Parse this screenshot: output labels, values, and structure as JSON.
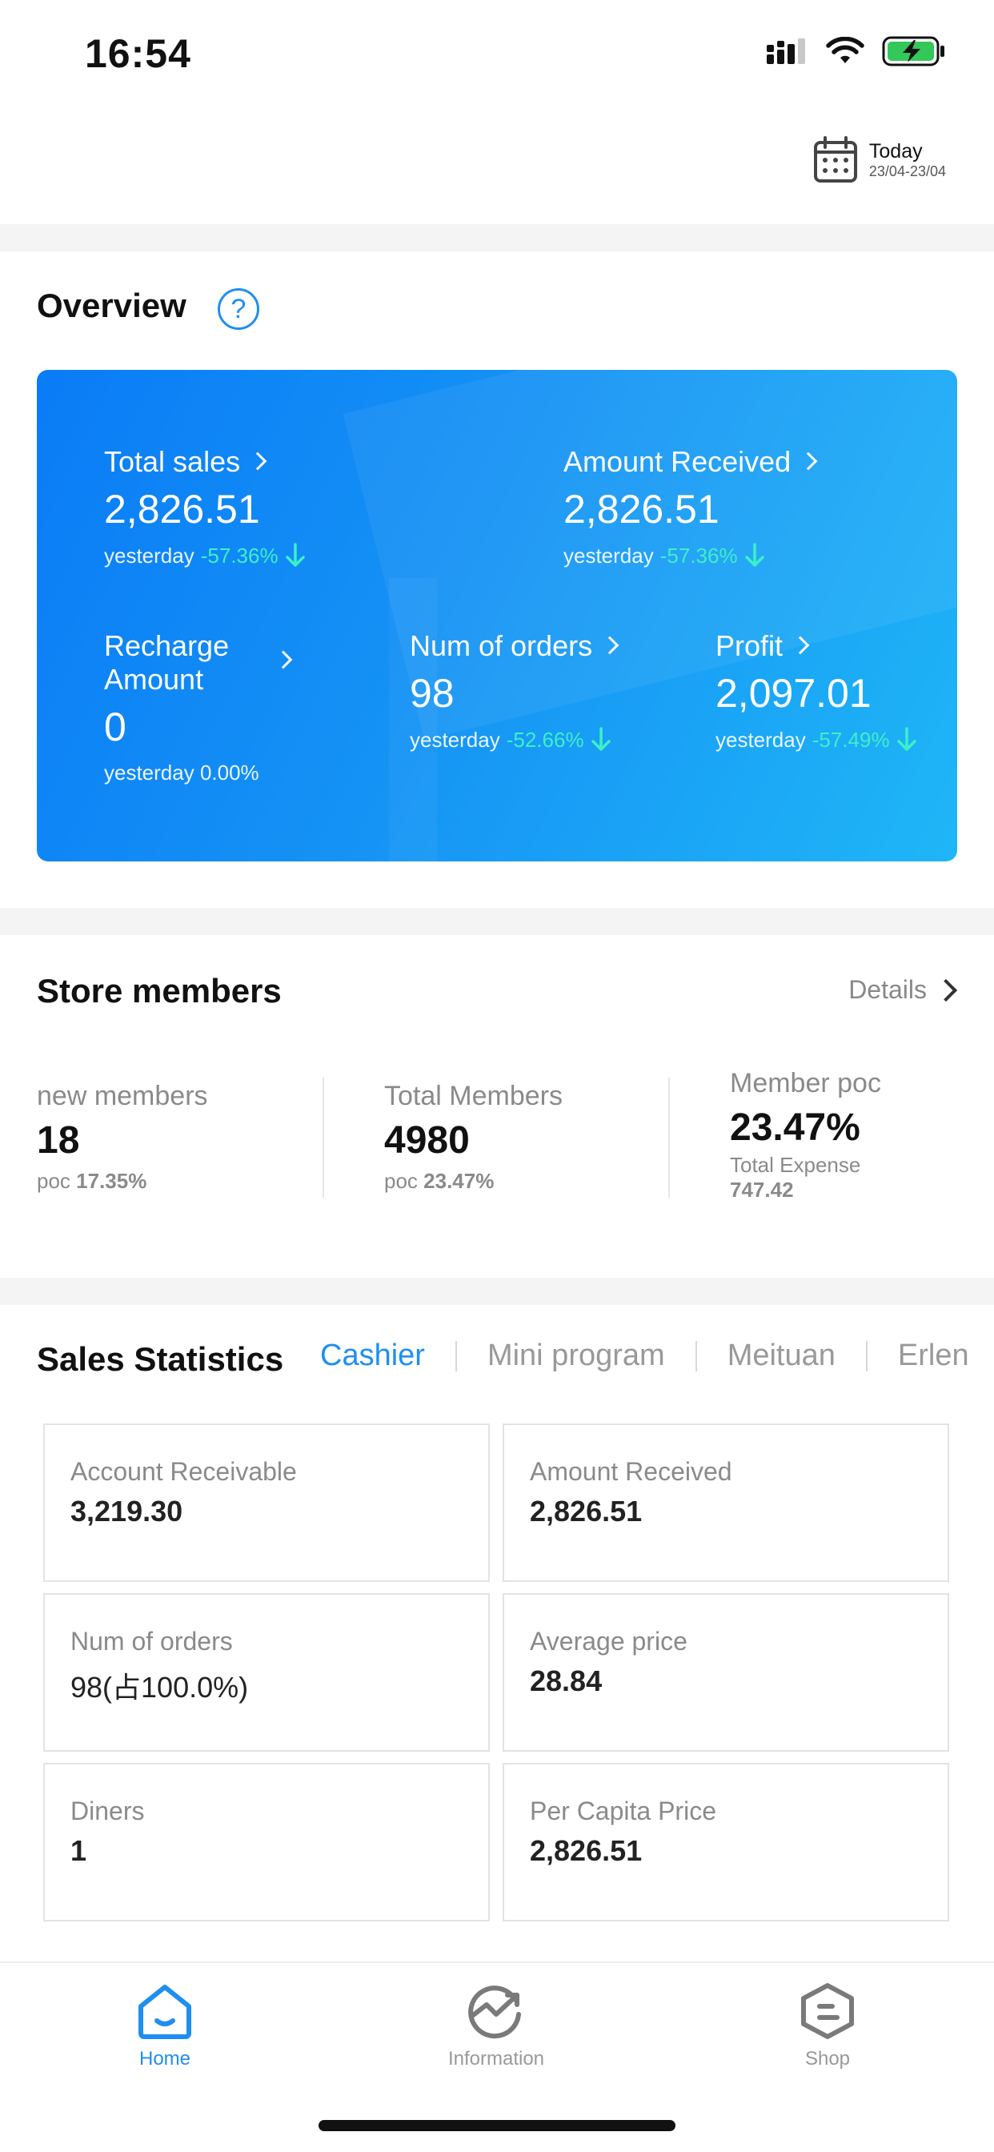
{
  "status_bar": {
    "time": "16:54",
    "icons": [
      "cellular-signal-icon",
      "wifi-icon",
      "battery-charging-icon"
    ]
  },
  "date_picker": {
    "label": "Today",
    "range": "23/04-23/04"
  },
  "overview": {
    "title": "Overview",
    "help_symbol": "?",
    "metrics": {
      "total_sales": {
        "label": "Total sales",
        "value": "2,826.51",
        "prefix": "yesterday",
        "change": "-57.36%"
      },
      "amount_received": {
        "label": "Amount Received",
        "value": "2,826.51",
        "prefix": "yesterday",
        "change": "-57.36%"
      },
      "recharge_amount": {
        "label_line1": "Recharge",
        "label_line2": "Amount",
        "value": "0",
        "sub": "yesterday 0.00%"
      },
      "num_orders": {
        "label": "Num of orders",
        "value": "98",
        "prefix": "yesterday",
        "change": "-52.66%"
      },
      "profit": {
        "label": "Profit",
        "value": "2,097.01",
        "prefix": "yesterday",
        "change": "-57.49%"
      }
    },
    "colors": {
      "card_start": "#0a7cf6",
      "card_end": "#1fb6f6",
      "change": "#3ef0c6"
    }
  },
  "store_members": {
    "title": "Store members",
    "details_label": "Details",
    "new_members": {
      "label": "new members",
      "value": "18",
      "sub_prefix": "poc",
      "sub_value": "17.35%"
    },
    "total_members": {
      "label": "Total Members",
      "value": "4980",
      "sub_prefix": "poc",
      "sub_value": "23.47%"
    },
    "member_poc": {
      "label": "Member poc",
      "value": "23.47%",
      "sub_label": "Total Expense",
      "sub_value": "747.42"
    }
  },
  "sales_statistics": {
    "title": "Sales Statistics",
    "tabs": [
      "Cashier",
      "Mini program",
      "Meituan",
      "Erlen"
    ],
    "active_tab": "Cashier",
    "boxes": [
      {
        "label": "Account Receivable",
        "value": "3,219.30"
      },
      {
        "label": "Amount Received",
        "value": "2,826.51"
      },
      {
        "label": "Num of orders",
        "value": "98(占100.0%)"
      },
      {
        "label": "Average price",
        "value": "28.84"
      },
      {
        "label": "Diners",
        "value": "1"
      },
      {
        "label": "Per Capita Price",
        "value": "2,826.51"
      }
    ]
  },
  "tab_bar": {
    "items": [
      {
        "label": "Home",
        "icon": "home-icon",
        "active": true
      },
      {
        "label": "Information",
        "icon": "trend-chart-icon",
        "active": false
      },
      {
        "label": "Shop",
        "icon": "shop-hexagon-icon",
        "active": false
      }
    ],
    "active_color": "#1e8ff0"
  }
}
